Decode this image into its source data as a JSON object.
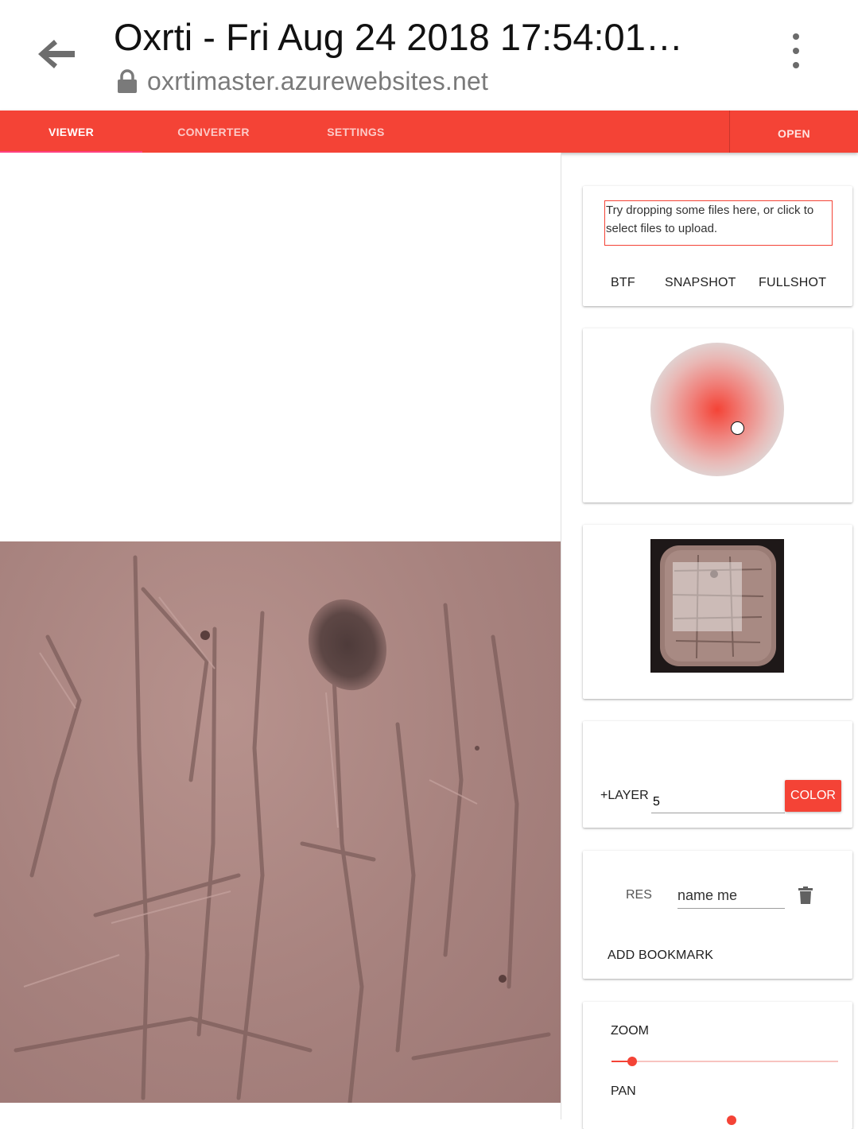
{
  "browser": {
    "title": "Oxrti - Fri Aug 24 2018 17:54:01…",
    "url": "oxrtimaster.azurewebsites.net"
  },
  "tabs": [
    {
      "label": "VIEWER",
      "active": true
    },
    {
      "label": "CONVERTER",
      "active": false
    },
    {
      "label": "SETTINGS",
      "active": false
    }
  ],
  "open_label": "OPEN",
  "upload": {
    "dropzone_text": "Try dropping some files here, or click to select files to upload.",
    "btf_label": "BTF",
    "snapshot_label": "SNAPSHOT",
    "fullshot_label": "FULLSHOT"
  },
  "layers": {
    "add_label": "+LAYER",
    "layer_value": "5",
    "color_label": "COLOR"
  },
  "bookmarks": {
    "res_label": "RES",
    "name_value": "name me",
    "add_label": "ADD BOOKMARK"
  },
  "controls": {
    "zoom_label": "ZOOM",
    "pan_label": "PAN"
  },
  "colors": {
    "accent": "#f44336",
    "tab_indicator": "#ff4081"
  }
}
